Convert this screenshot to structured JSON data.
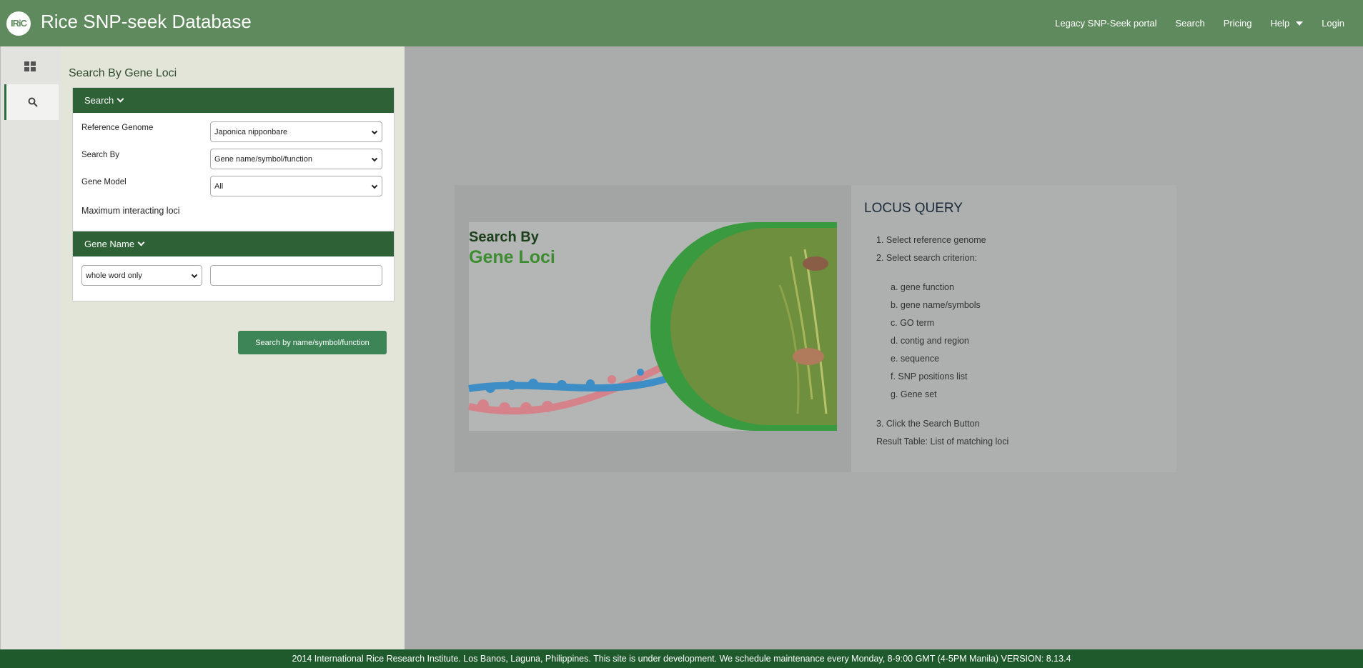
{
  "header": {
    "logo_text": "IRiC",
    "title": "Rice SNP-seek Database",
    "nav": {
      "legacy": "Legacy SNP-Seek portal",
      "search": "Search",
      "pricing": "Pricing",
      "help": "Help",
      "login": "Login"
    }
  },
  "rail": {
    "items": [
      "grid-icon",
      "search-icon"
    ],
    "active": "search-icon"
  },
  "panel": {
    "title": "Search By Gene Loci",
    "search_section": {
      "header": "Search",
      "reference_genome_label": "Reference Genome",
      "reference_genome_value": "Japonica nipponbare",
      "search_by_label": "Search By",
      "search_by_value": "Gene name/symbol/function",
      "gene_model_label": "Gene Model",
      "gene_model_value": "All",
      "max_loci_label": "Maximum interacting loci"
    },
    "gene_name_section": {
      "header": "Gene Name",
      "match_value": "whole word only",
      "text_value": ""
    },
    "submit_label": "Search by name/symbol/function"
  },
  "info": {
    "banner_line1": "Search By",
    "banner_line2": "Gene Loci",
    "heading": "LOCUS QUERY",
    "step1": "1. Select reference genome",
    "step2": "2. Select search criterion:",
    "criteria": [
      "a. gene function",
      "b. gene name/symbols",
      "c. GO term",
      "d. contig and region",
      "e. sequence",
      "f. SNP positions list",
      "g. Gene set"
    ],
    "step3": "3. Click the Search Button",
    "result": "Result Table: List of matching loci"
  },
  "footer": {
    "text": "2014 International Rice Research Institute. Los Banos, Laguna, Philippines. This site is under development. We schedule maintenance every Monday, 8-9:00 GMT (4-5PM Manila) VERSION: 8.13.4"
  },
  "colors": {
    "nav": "#5f8a5d",
    "section_header": "#2e6135",
    "button": "#3d8557",
    "footer": "#1e5a2c"
  }
}
